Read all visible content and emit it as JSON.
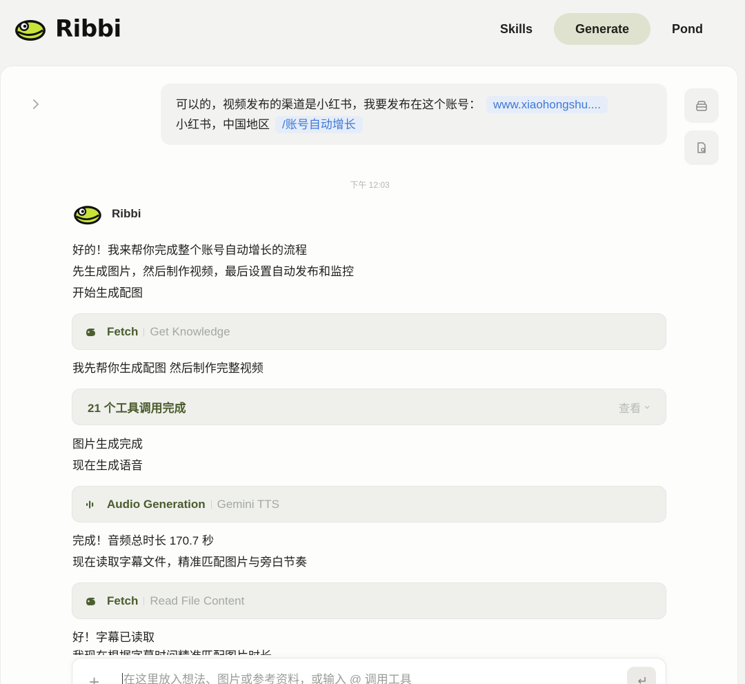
{
  "brand": {
    "name": "Ribbi"
  },
  "nav": {
    "items": [
      {
        "label": "Skills",
        "active": false
      },
      {
        "label": "Generate",
        "active": true
      },
      {
        "label": "Pond",
        "active": false
      }
    ]
  },
  "user_message": {
    "line1_text": "可以的，视频发布的渠道是小红书，我要发布在这个账号：",
    "line1_chip": "www.xiaohongshu....",
    "line2_text": "小红书，中国地区",
    "line2_chip": "/账号自动增长"
  },
  "timestamp": "下午 12:03",
  "assistant": {
    "name": "Ribbi",
    "intro_lines": [
      "好的！我来帮你完成整个账号自动增长的流程",
      "先生成图片，然后制作视频，最后设置自动发布和监控",
      "开始生成配图"
    ],
    "tool_fetch_1": {
      "name": "Fetch",
      "detail": "Get Knowledge",
      "icon": "fetch-hand-icon"
    },
    "line_after_fetch": "我先帮你生成配图 然后制作完整视频",
    "tool_summary": {
      "label": "21 个工具调用完成",
      "toggle": "查看"
    },
    "lines_after_summary": [
      "图片生成完成",
      "现在生成语音"
    ],
    "tool_audio": {
      "name": "Audio Generation",
      "detail": "Gemini TTS",
      "icon": "audio-wave-icon"
    },
    "lines_after_audio": [
      "完成！音频总时长 170.7 秒",
      "现在读取字幕文件，精准匹配图片与旁白节奏"
    ],
    "tool_fetch_2": {
      "name": "Fetch",
      "detail": "Read File Content",
      "icon": "fetch-hand-icon"
    },
    "lines_after_fetch_2": [
      "好！字幕已读取"
    ],
    "partial_line": "我现在根据字幕时间精准匹配图片时长"
  },
  "composer": {
    "placeholder": "在这里放入想法、图片或参考资料，或输入 @ 调用工具",
    "plus_icon": "plus-icon",
    "send_icon": "enter-icon"
  },
  "colors": {
    "accent_green": "#4a5c2c",
    "active_nav_bg": "#dfe2cf",
    "chip_blue": "#3d79d8",
    "logo_lime": "#c8e33a"
  }
}
